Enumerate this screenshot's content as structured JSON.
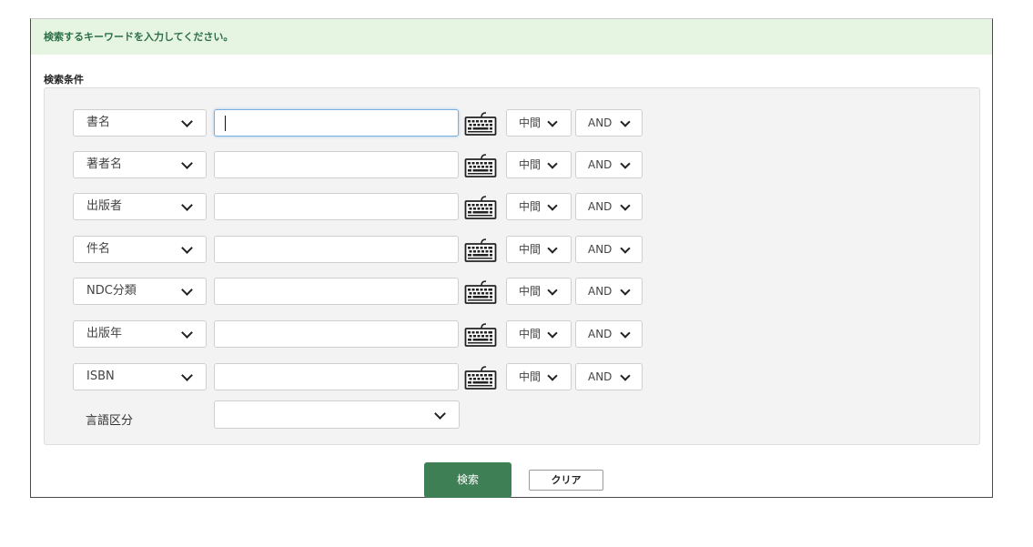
{
  "message": "検索するキーワードを入力してください。",
  "conditions_title": "検索条件",
  "rows": [
    {
      "field": "書名",
      "match": "中間",
      "operator": "AND"
    },
    {
      "field": "著者名",
      "match": "中間",
      "operator": "AND"
    },
    {
      "field": "出版者",
      "match": "中間",
      "operator": "AND"
    },
    {
      "field": "件名",
      "match": "中間",
      "operator": "AND"
    },
    {
      "field": "NDC分類",
      "match": "中間",
      "operator": "AND"
    },
    {
      "field": "出版年",
      "match": "中間",
      "operator": "AND"
    },
    {
      "field": "ISBN",
      "match": "中間",
      "operator": "AND"
    }
  ],
  "language": {
    "label": "言語区分",
    "value": ""
  },
  "buttons": {
    "search": "検索",
    "clear": "クリア"
  },
  "icons": {
    "keyboard": "keyboard-icon",
    "dropdown": "chevron-down-icon"
  },
  "colors": {
    "accent": "#3f7f55",
    "message_bg": "#e6f5e1",
    "message_text": "#2d6e47"
  }
}
